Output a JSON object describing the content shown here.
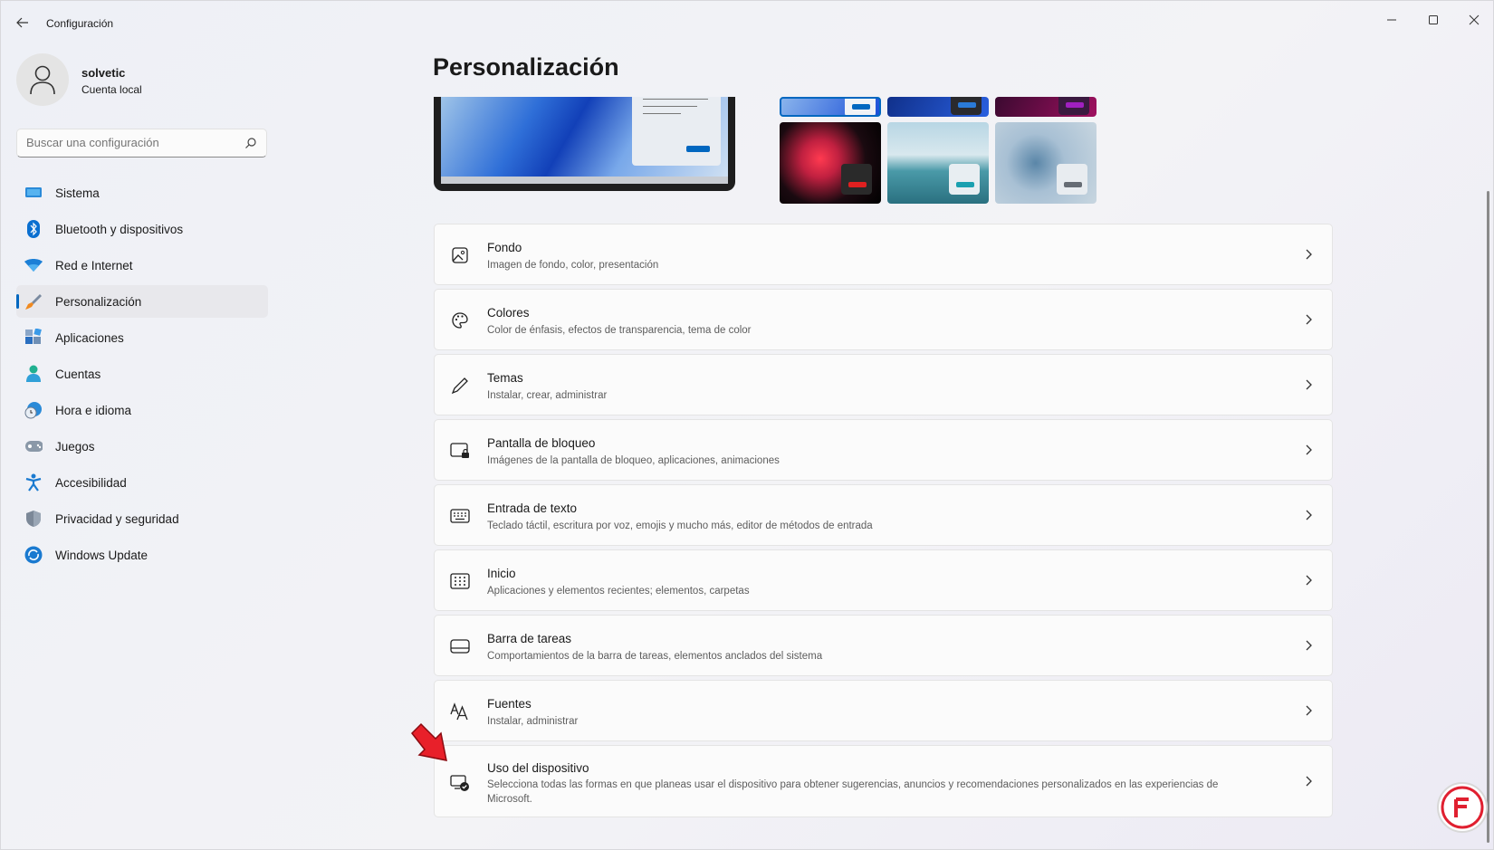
{
  "window": {
    "title": "Configuración"
  },
  "profile": {
    "name": "solvetic",
    "account_type": "Cuenta local"
  },
  "search": {
    "placeholder": "Buscar una configuración",
    "value": ""
  },
  "sidebar": {
    "items": [
      {
        "label": "Sistema",
        "icon": "monitor-icon",
        "active": false
      },
      {
        "label": "Bluetooth y dispositivos",
        "icon": "bluetooth-icon",
        "active": false
      },
      {
        "label": "Red e Internet",
        "icon": "wifi-icon",
        "active": false
      },
      {
        "label": "Personalización",
        "icon": "brush-icon",
        "active": true
      },
      {
        "label": "Aplicaciones",
        "icon": "apps-icon",
        "active": false
      },
      {
        "label": "Cuentas",
        "icon": "person-icon",
        "active": false
      },
      {
        "label": "Hora e idioma",
        "icon": "clock-globe-icon",
        "active": false
      },
      {
        "label": "Juegos",
        "icon": "gamepad-icon",
        "active": false
      },
      {
        "label": "Accesibilidad",
        "icon": "accessibility-icon",
        "active": false
      },
      {
        "label": "Privacidad y seguridad",
        "icon": "shield-icon",
        "active": false
      },
      {
        "label": "Windows Update",
        "icon": "update-icon",
        "active": false
      }
    ]
  },
  "main": {
    "title": "Personalización",
    "cards": [
      {
        "title": "Fondo",
        "subtitle": "Imagen de fondo, color, presentación",
        "icon": "image-icon"
      },
      {
        "title": "Colores",
        "subtitle": "Color de énfasis, efectos de transparencia, tema de color",
        "icon": "palette-icon"
      },
      {
        "title": "Temas",
        "subtitle": "Instalar, crear, administrar",
        "icon": "pen-icon"
      },
      {
        "title": "Pantalla de bloqueo",
        "subtitle": "Imágenes de la pantalla de bloqueo, aplicaciones, animaciones",
        "icon": "lock-screen-icon"
      },
      {
        "title": "Entrada de texto",
        "subtitle": "Teclado táctil, escritura por voz, emojis y mucho más, editor de métodos de entrada",
        "icon": "keyboard-icon"
      },
      {
        "title": "Inicio",
        "subtitle": "Aplicaciones y elementos recientes; elementos, carpetas",
        "icon": "start-grid-icon"
      },
      {
        "title": "Barra de tareas",
        "subtitle": "Comportamientos de la barra de tareas, elementos anclados del sistema",
        "icon": "taskbar-icon"
      },
      {
        "title": "Fuentes",
        "subtitle": "Instalar, administrar",
        "icon": "font-icon"
      },
      {
        "title": "Uso del dispositivo",
        "subtitle": "Selecciona todas las formas en que planeas usar el dispositivo para obtener sugerencias, anuncios y recomendaciones personalizados en las experiencias de Microsoft.",
        "icon": "device-usage-icon"
      }
    ]
  },
  "colors": {
    "accent": "#0067c0",
    "arrow": "#e8202a"
  }
}
